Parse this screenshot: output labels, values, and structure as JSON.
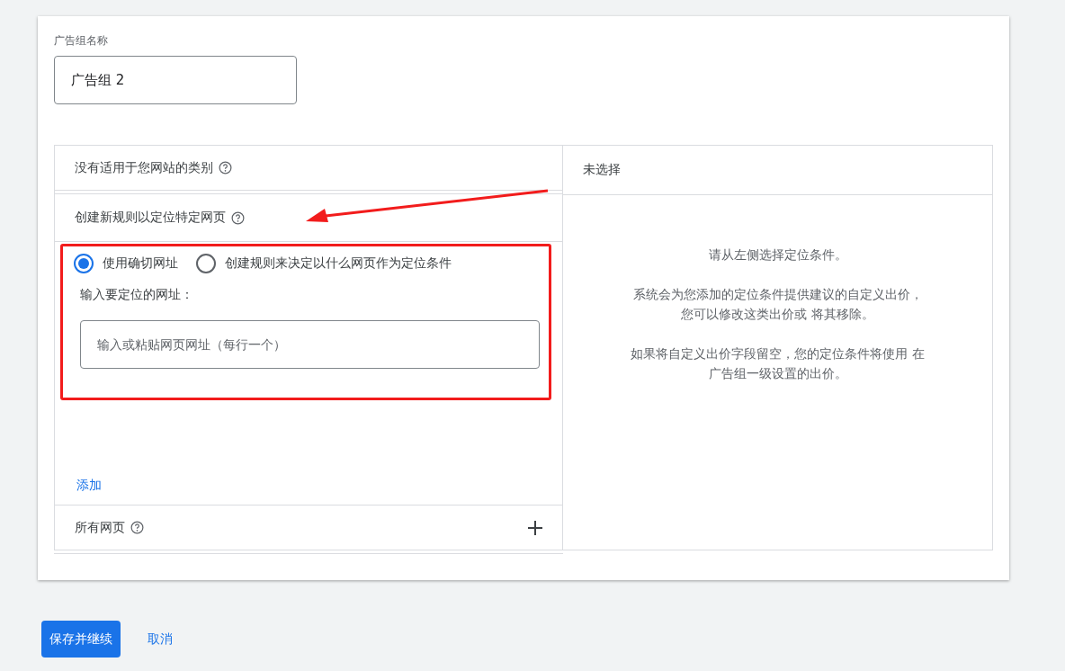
{
  "ad_group_name": {
    "label": "广告组名称",
    "value": "广告组 2"
  },
  "left_panel": {
    "category_row": {
      "label": "没有适用于您网站的类别"
    },
    "rule_row": {
      "label": "创建新规则以定位特定网页"
    },
    "options": [
      {
        "label": "使用确切网址",
        "selected": true
      },
      {
        "label": "创建规则来决定以什么网页作为定位条件",
        "selected": false
      }
    ],
    "url_label": "输入要定位的网址：",
    "url_field": {
      "placeholder": "输入或粘贴网页网址（每行一个）"
    },
    "add_link": "添加",
    "all_pages_row": {
      "label": "所有网页"
    }
  },
  "right_panel": {
    "header": "未选择",
    "paragraphs": [
      "请从左侧选择定位条件。",
      "系统会为您添加的定位条件提供建议的自定义出价，您可以修改这类出价或 将其移除。",
      "如果将自定义出价字段留空，您的定位条件将使用 在广告组一级设置的出价。"
    ]
  },
  "buttons": [
    {
      "label": "保存并继续",
      "kind": "primary"
    },
    {
      "label": "取消",
      "kind": "text"
    }
  ]
}
